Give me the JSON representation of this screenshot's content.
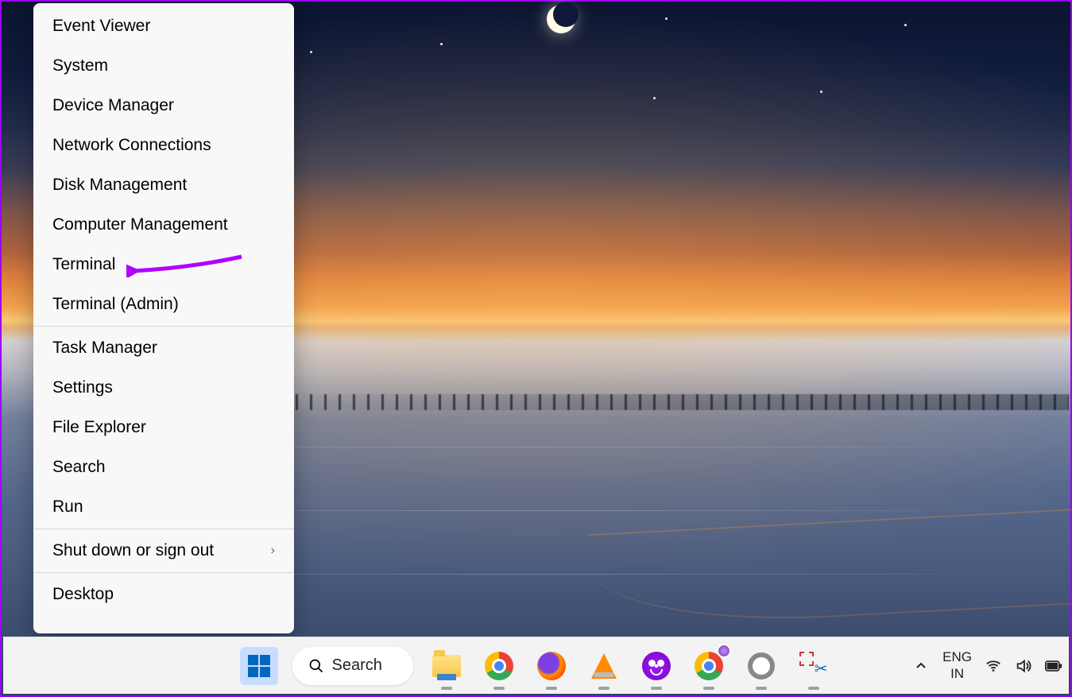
{
  "annotation": {
    "arrow_color": "#b000ff",
    "points_to": "Terminal"
  },
  "winx_menu": {
    "groups": [
      [
        "Event Viewer",
        "System",
        "Device Manager",
        "Network Connections",
        "Disk Management",
        "Computer Management",
        "Terminal",
        "Terminal (Admin)"
      ],
      [
        "Task Manager",
        "Settings",
        "File Explorer",
        "Search",
        "Run"
      ],
      [
        "Shut down or sign out"
      ],
      [
        "Desktop"
      ]
    ],
    "submenu_items": [
      "Shut down or sign out"
    ]
  },
  "taskbar": {
    "search_label": "Search",
    "apps": [
      {
        "name": "start",
        "icon": "windows-icon",
        "running": false
      },
      {
        "name": "search",
        "icon": "search-icon",
        "running": false
      },
      {
        "name": "file-explorer",
        "icon": "folder-icon",
        "running": true
      },
      {
        "name": "chrome",
        "icon": "chrome-icon",
        "running": true
      },
      {
        "name": "firefox",
        "icon": "firefox-icon",
        "running": true
      },
      {
        "name": "vlc",
        "icon": "vlc-icon",
        "running": true
      },
      {
        "name": "purple-app",
        "icon": "infinity-icon",
        "running": true
      },
      {
        "name": "chrome-profile",
        "icon": "chrome-icon",
        "running": true
      },
      {
        "name": "settings",
        "icon": "gear-icon",
        "running": true
      },
      {
        "name": "snipping-tool",
        "icon": "scissors-icon",
        "running": true
      }
    ],
    "tray": {
      "chevron": "chevron-up-icon",
      "language_line1": "ENG",
      "language_line2": "IN",
      "wifi": "wifi-icon",
      "volume": "volume-icon",
      "battery": "battery-icon"
    }
  }
}
